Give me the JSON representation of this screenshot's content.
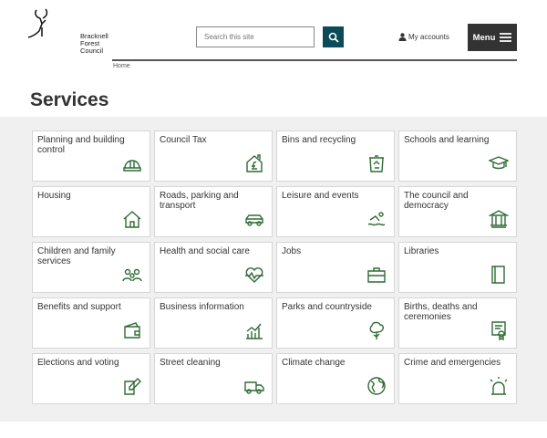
{
  "header": {
    "logo_text": [
      "Bracknell",
      "Forest",
      "Council"
    ],
    "search_placeholder": "Search this site",
    "my_accounts": "My accounts",
    "menu": "Menu"
  },
  "breadcrumb": "Home",
  "title": "Services",
  "services": [
    {
      "label": "Planning and building control",
      "icon": "hard-hat-icon"
    },
    {
      "label": "Council Tax",
      "icon": "house-pound-icon"
    },
    {
      "label": "Bins and recycling",
      "icon": "recycling-bin-icon"
    },
    {
      "label": "Schools and learning",
      "icon": "graduation-cap-icon"
    },
    {
      "label": "Housing",
      "icon": "house-icon"
    },
    {
      "label": "Roads, parking and transport",
      "icon": "car-icon"
    },
    {
      "label": "Leisure and events",
      "icon": "swimmer-icon"
    },
    {
      "label": "The council and democracy",
      "icon": "building-columns-icon"
    },
    {
      "label": "Children and family services",
      "icon": "family-icon"
    },
    {
      "label": "Health and social care",
      "icon": "heartbeat-icon"
    },
    {
      "label": "Jobs",
      "icon": "briefcase-icon"
    },
    {
      "label": "Libraries",
      "icon": "book-icon"
    },
    {
      "label": "Benefits and support",
      "icon": "wallet-icon"
    },
    {
      "label": "Business information",
      "icon": "bar-chart-icon"
    },
    {
      "label": "Parks and countryside",
      "icon": "tree-icon"
    },
    {
      "label": "Births, deaths and ceremonies",
      "icon": "certificate-icon"
    },
    {
      "label": "Elections and voting",
      "icon": "ballot-pen-icon"
    },
    {
      "label": "Street cleaning",
      "icon": "truck-icon"
    },
    {
      "label": "Climate change",
      "icon": "globe-icon"
    },
    {
      "label": "Crime and emergencies",
      "icon": "siren-icon"
    }
  ],
  "colors": {
    "accent": "#0a4b57",
    "icon": "#2e6b35",
    "menu_bg": "#333333"
  }
}
